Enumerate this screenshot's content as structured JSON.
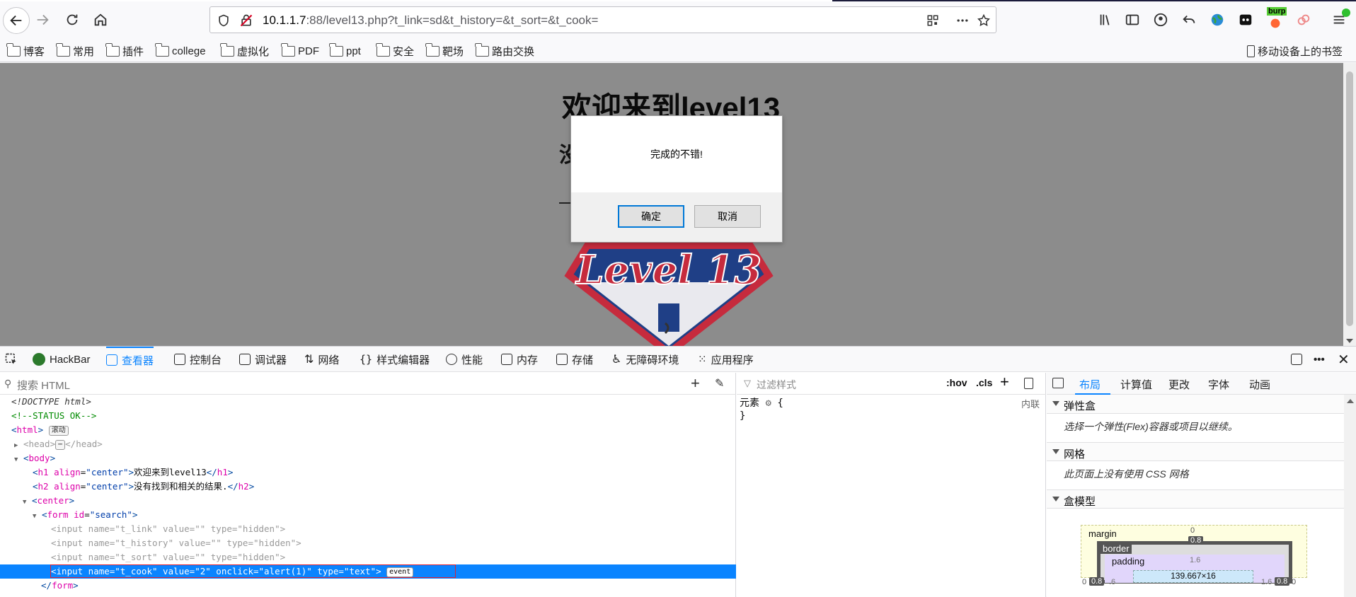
{
  "browser": {
    "url_host": "10.1.1.7",
    "url_rest": ":88/level13.php?t_link=sd&t_history=&t_sort=&t_cook=",
    "burp_label": "burp"
  },
  "bookmarks": {
    "items": [
      "博客",
      "常用",
      "插件",
      "college",
      "虚拟化",
      "PDF",
      "ppt",
      "安全",
      "靶场",
      "路由交换"
    ],
    "mobile": "移动设备上的书签"
  },
  "page": {
    "h1": "欢迎来到level13",
    "h2_visible": "没",
    "logo_text": "Level 13"
  },
  "dialog": {
    "message": "完成的不错!",
    "ok": "确定",
    "cancel": "取消"
  },
  "devtools": {
    "tabs": [
      "HackBar",
      "查看器",
      "控制台",
      "调试器",
      "网络",
      "样式编辑器",
      "性能",
      "内存",
      "存储",
      "无障碍环境",
      "应用程序"
    ],
    "active_tab": "查看器",
    "search_placeholder": "搜索 HTML",
    "filter_placeholder": "过滤样式",
    "hov": ":hov",
    "cls": ".cls",
    "rule_selector": "元素",
    "rule_open": "{",
    "rule_close": "}",
    "rule_source": "内联",
    "layout_tabs": [
      "布局",
      "计算值",
      "更改",
      "字体",
      "动画"
    ],
    "flex_title": "弹性盒",
    "flex_note": "选择一个弹性(Flex)容器或项目以继续。",
    "grid_title": "网格",
    "grid_note": "此页面上没有使用 CSS 网格",
    "boxmodel_title": "盒模型",
    "boxmodel": {
      "margin_label": "margin",
      "margin_top": "0",
      "border_label": "border",
      "border_val": "0.8",
      "padding_label": "padding",
      "padding_val": "1.6",
      "content_size": "139.667×16",
      "left_margin": "0",
      "left_border": "0.8",
      "left_pad": ".6",
      "right_pad": "1.6",
      "right_border": "0.8",
      "right_margin": "0"
    }
  },
  "tree": {
    "doctype": "<!DOCTYPE html>",
    "comment": "<!--STATUS OK-->",
    "html_badge": "滚动",
    "h1_text": "欢迎来到level13",
    "h2_text": "没有找到和相关的结果.",
    "event_badge": "event"
  }
}
